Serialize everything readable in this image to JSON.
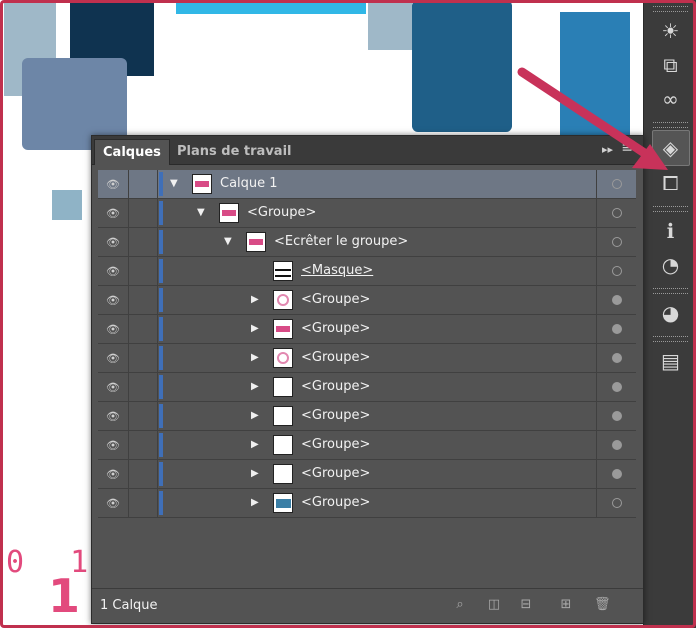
{
  "panel": {
    "tabs": [
      {
        "label": "Calques"
      },
      {
        "label": "Plans de travail"
      }
    ],
    "menu_glyph": "▸▸",
    "footer_count": "1 Calque"
  },
  "layers": [
    {
      "label": "Calque 1",
      "depth": 0,
      "twirl": "▼",
      "thumb": "pink",
      "selected": true,
      "target_filled": false
    },
    {
      "label": "<Groupe>",
      "depth": 1,
      "twirl": "▼",
      "thumb": "pink",
      "selected": false,
      "target_filled": false
    },
    {
      "label": "<Ecrêter le groupe>",
      "depth": 2,
      "twirl": "▼",
      "thumb": "pink",
      "selected": false,
      "target_filled": false
    },
    {
      "label": "<Masque>",
      "depth": 3,
      "twirl": "",
      "thumb": "mask",
      "selected": false,
      "underline": true,
      "target_filled": false
    },
    {
      "label": "<Groupe>",
      "depth": 3,
      "twirl": "▶",
      "thumb": "pinkblob",
      "selected": false,
      "target_filled": true
    },
    {
      "label": "<Groupe>",
      "depth": 3,
      "twirl": "▶",
      "thumb": "pink",
      "selected": false,
      "target_filled": true
    },
    {
      "label": "<Groupe>",
      "depth": 3,
      "twirl": "▶",
      "thumb": "pinkblob",
      "selected": false,
      "target_filled": true
    },
    {
      "label": "<Groupe>",
      "depth": 3,
      "twirl": "▶",
      "thumb": "blank",
      "selected": false,
      "target_filled": true
    },
    {
      "label": "<Groupe>",
      "depth": 3,
      "twirl": "▶",
      "thumb": "blank",
      "selected": false,
      "target_filled": true
    },
    {
      "label": "<Groupe>",
      "depth": 3,
      "twirl": "▶",
      "thumb": "blank",
      "selected": false,
      "target_filled": true
    },
    {
      "label": "<Groupe>",
      "depth": 3,
      "twirl": "▶",
      "thumb": "blank",
      "selected": false,
      "target_filled": true
    },
    {
      "label": "<Groupe>",
      "depth": 3,
      "twirl": "▶",
      "thumb": "blue",
      "selected": false,
      "target_filled": false
    }
  ],
  "canvas": {
    "digits": "0 1 0",
    "big_digit": "1"
  },
  "dock": {
    "icons": [
      "brightness-icon",
      "artboard-export-icon",
      "creative-cloud-icon",
      "layers-icon",
      "pathfinder-icon",
      "info-icon",
      "appearance-icon",
      "color-guide-icon",
      "artboards-icon"
    ]
  },
  "colors": {
    "frame": "#c0304e",
    "arrow": "#c8325a",
    "layer_color": "#3f6fb8",
    "selected_row": "#6e7785"
  }
}
